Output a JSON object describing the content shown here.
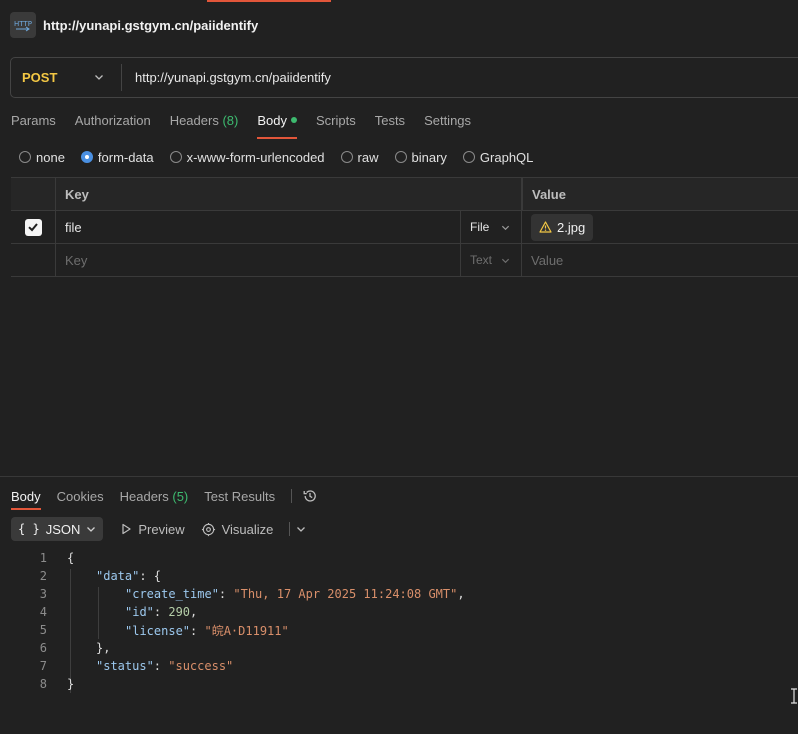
{
  "window": {
    "title": "http://yunapi.gstgym.cn/paiidentify"
  },
  "request": {
    "method": "POST",
    "url": "http://yunapi.gstgym.cn/paiidentify",
    "tabs": {
      "params": "Params",
      "authorization": "Authorization",
      "headers": "Headers",
      "headers_count": "(8)",
      "body": "Body",
      "scripts": "Scripts",
      "tests": "Tests",
      "settings": "Settings"
    },
    "body_types": [
      {
        "label": "none",
        "selected": false
      },
      {
        "label": "form-data",
        "selected": true
      },
      {
        "label": "x-www-form-urlencoded",
        "selected": false
      },
      {
        "label": "raw",
        "selected": false
      },
      {
        "label": "binary",
        "selected": false
      },
      {
        "label": "GraphQL",
        "selected": false
      }
    ],
    "table": {
      "key_header": "Key",
      "value_header": "Value",
      "rows": [
        {
          "checked": true,
          "key": "file",
          "type": "File",
          "value": "2.jpg"
        }
      ],
      "placeholder": {
        "key": "Key",
        "type": "Text",
        "value": "Value"
      }
    }
  },
  "response": {
    "tabs": {
      "body": "Body",
      "cookies": "Cookies",
      "headers": "Headers",
      "headers_count": "(5)",
      "test_results": "Test Results"
    },
    "toolbar": {
      "format": "JSON",
      "preview": "Preview",
      "visualize": "Visualize"
    },
    "lines": [
      {
        "n": "1",
        "text": "{"
      },
      {
        "n": "2",
        "key": "\"data\"",
        "rest": ": {"
      },
      {
        "n": "3",
        "key": "\"create_time\"",
        "sep": ": ",
        "str": "\"Thu, 17 Apr 2025 11:24:08 GMT\"",
        "end": ","
      },
      {
        "n": "4",
        "key": "\"id\"",
        "sep": ": ",
        "num": "290",
        "end": ","
      },
      {
        "n": "5",
        "key": "\"license\"",
        "sep": ": ",
        "str": "\"皖A·D11911\""
      },
      {
        "n": "6",
        "text": "},"
      },
      {
        "n": "7",
        "key": "\"status\"",
        "sep": ": ",
        "str": "\"success\""
      },
      {
        "n": "8",
        "text": "}"
      }
    ]
  },
  "colors": {
    "accent": "#e2563a",
    "method": "#f3c744",
    "count": "#3dba6f",
    "radio_selected": "#4a90e2"
  }
}
